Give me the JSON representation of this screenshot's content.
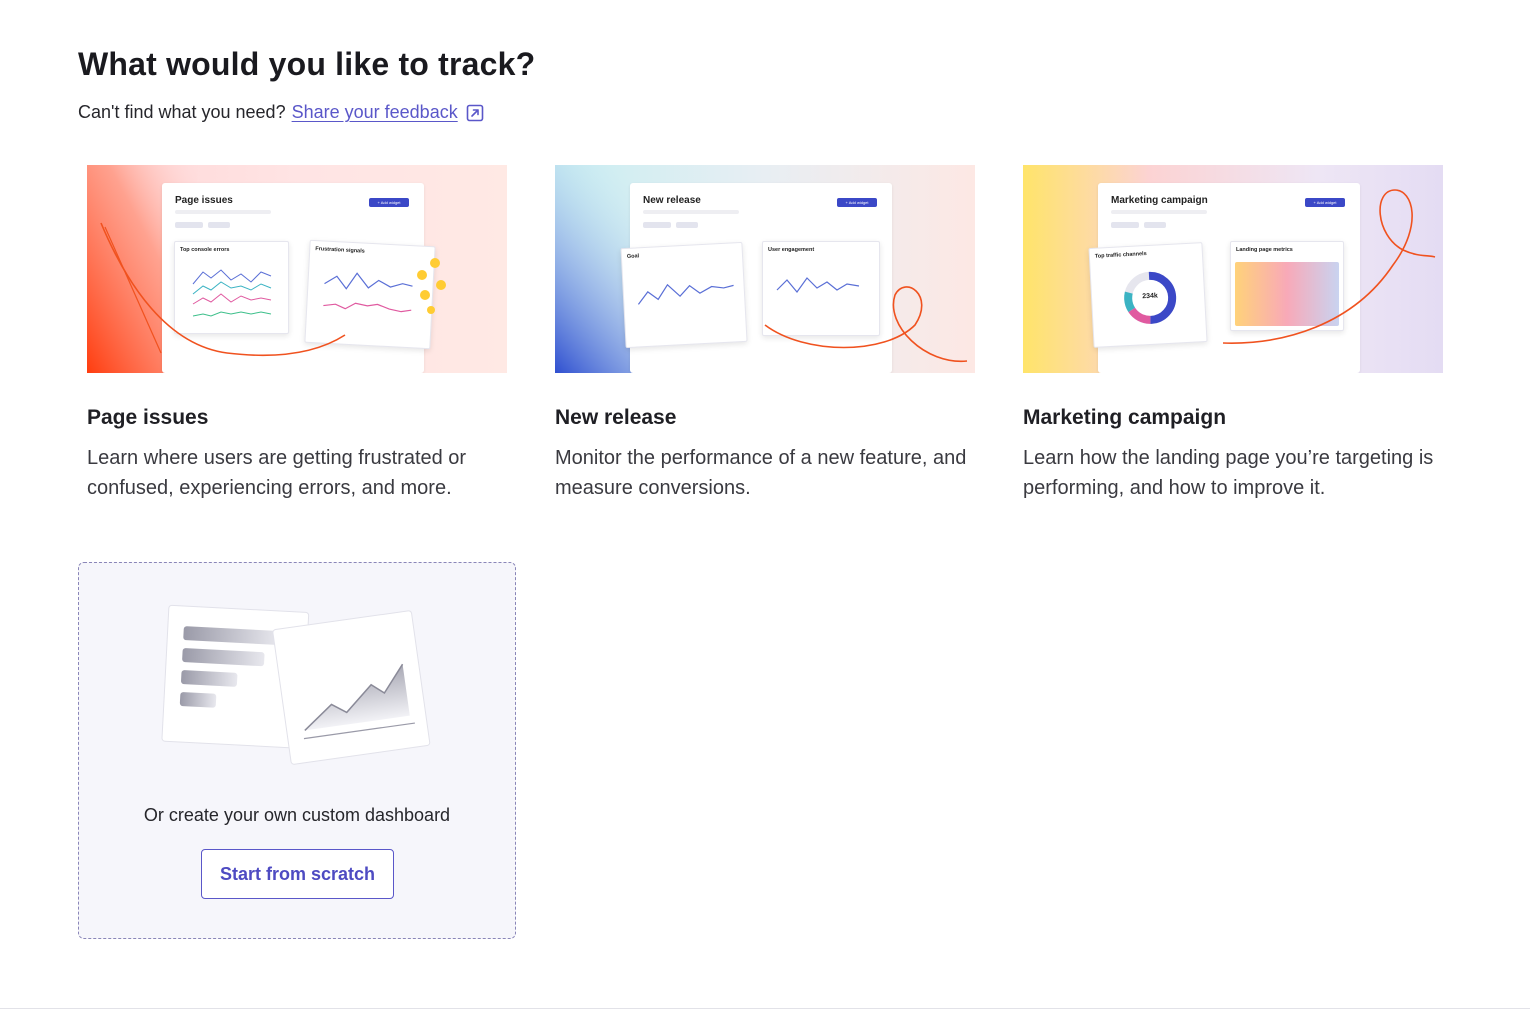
{
  "header": {
    "title": "What would you like to track?",
    "feedback_prompt": "Can't find what you need?",
    "feedback_link": "Share your feedback",
    "feedback_icon": "external-link-icon"
  },
  "templates": [
    {
      "title": "Page issues",
      "description": "Learn where users are getting frustrated or confused, experiencing errors, and more.",
      "preview": {
        "title": "Page issues",
        "button": "+ Add widget",
        "widgets": [
          "Top console errors",
          "Frustration signals"
        ]
      }
    },
    {
      "title": "New release",
      "description": "Monitor the performance of a new feature, and measure conversions.",
      "preview": {
        "title": "New release",
        "button": "+ Add widget",
        "widgets": [
          "Goal",
          "User engagement"
        ]
      }
    },
    {
      "title": "Marketing campaign",
      "description": "Learn how the landing page you’re targeting is performing, and how to improve it.",
      "preview": {
        "title": "Marketing campaign",
        "button": "+ Add widget",
        "widgets": [
          "Top traffic channels",
          "Landing page metrics"
        ],
        "donut_value": "234k"
      }
    }
  ],
  "custom": {
    "text": "Or create your own custom dashboard",
    "button": "Start from scratch"
  },
  "colors": {
    "accent": "#5a57c9",
    "accent_dark": "#3b48c7",
    "squiggle": "#f0521f"
  }
}
